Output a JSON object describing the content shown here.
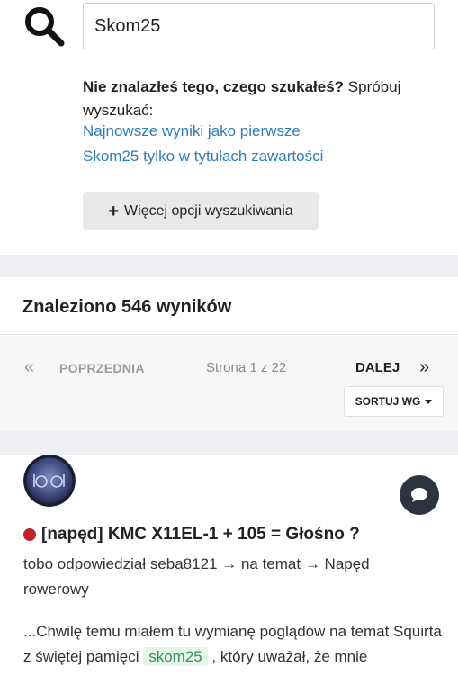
{
  "search": {
    "value": "Skom25"
  },
  "not_found": {
    "bold": "Nie znalazłeś tego, czego szukałeś?",
    "rest": " Spróbuj wyszukać:"
  },
  "suggestions": [
    "Najnowsze wyniki jako pierwsze",
    "Skom25 tylko w tytułach zawartości"
  ],
  "more_options": {
    "icon": "+",
    "label": "Więcej opcji wyszukiwania"
  },
  "results": {
    "title": "Znaleziono 546 wyników"
  },
  "pagination": {
    "prev_arrow": "«",
    "prev_label": "POPRZEDNIA",
    "page_text": "Strona 1 z 22",
    "next_label": "DALEJ",
    "next_arrow": "»"
  },
  "sort": {
    "label": "SORTUJ WG"
  },
  "result_item": {
    "title": "[napęd] KMC X11EL-1 + 105 = Głośno ?",
    "meta": "tobo odpowiedział seba8121 → na temat → Napęd rowerowy",
    "snippet_before": "...Chwilę temu miałem tu wymianę poglądów na temat Squirta z świętej pamięci ",
    "snippet_highlight": "skom25",
    "snippet_after": " , który uważał, że mnie"
  },
  "colors": {
    "link": "#2f7db8",
    "hot_dot": "#c0242a",
    "highlight_bg": "#e4f5e9",
    "highlight_text": "#3a8d58",
    "band": "#eeeff2"
  },
  "icons": {
    "search": "search-icon",
    "comment": "chat-bubble-icon",
    "avatar": "user-avatar"
  }
}
